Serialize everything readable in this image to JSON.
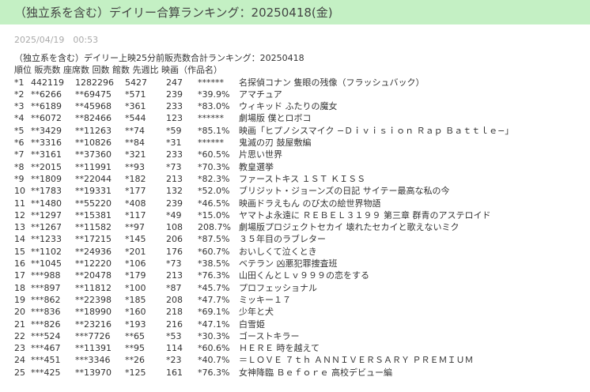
{
  "header": {
    "title": "（独立系を含む）デイリー合算ランキング：20250418(金)"
  },
  "post": {
    "date": "2025/04/19　00:53",
    "subtitle": "（独立系を含む）デイリー上映25分前販売数合計ランキング：20250418",
    "columns_line": "順位 販売数 座席数 回数 館数 先週比 映画（作品名）"
  },
  "ranking": [
    {
      "rank": "*1",
      "sales": "442119",
      "seats": "1282296",
      "shows": "5427",
      "halls": "247",
      "ratio": "******",
      "title": "名探偵コナン 隻眼の残像（フラッシュバック）"
    },
    {
      "rank": "*2",
      "sales": "**6266",
      "seats": "**69475",
      "shows": "*571",
      "halls": "239",
      "ratio": "*39.9%",
      "title": "アマチュア"
    },
    {
      "rank": "*3",
      "sales": "**6189",
      "seats": "**45968",
      "shows": "*361",
      "halls": "233",
      "ratio": "*83.0%",
      "title": "ウィキッド ふたりの魔女"
    },
    {
      "rank": "*4",
      "sales": "**6072",
      "seats": "**82466",
      "shows": "*544",
      "halls": "123",
      "ratio": "******",
      "title": "劇場版 僕とロボコ"
    },
    {
      "rank": "*5",
      "sales": "**3429",
      "seats": "**11263",
      "shows": "**74",
      "halls": "*59",
      "ratio": "*85.1%",
      "title": "映画「ヒプノシスマイク −Ｄｉｖｉｓｉｏｎ Ｒａｐ Ｂａｔｔｌｅ−」"
    },
    {
      "rank": "*6",
      "sales": "**3316",
      "seats": "**10826",
      "shows": "**84",
      "halls": "*31",
      "ratio": "******",
      "title": "鬼滅の刃 鼓屋敷編"
    },
    {
      "rank": "*7",
      "sales": "**3161",
      "seats": "**37360",
      "shows": "*321",
      "halls": "233",
      "ratio": "*60.5%",
      "title": "片思い世界"
    },
    {
      "rank": "*8",
      "sales": "**2015",
      "seats": "**11991",
      "shows": "**93",
      "halls": "*73",
      "ratio": "*70.3%",
      "title": "教皇選挙"
    },
    {
      "rank": "*9",
      "sales": "**1809",
      "seats": "**22044",
      "shows": "*182",
      "halls": "213",
      "ratio": "*82.3%",
      "title": "ファーストキス １ＳＴ ＫＩＳＳ"
    },
    {
      "rank": "10",
      "sales": "**1783",
      "seats": "**19331",
      "shows": "*177",
      "halls": "132",
      "ratio": "*52.0%",
      "title": "ブリジット・ジョーンズの日記 サイテー最高な私の今"
    },
    {
      "rank": "11",
      "sales": "**1480",
      "seats": "**55220",
      "shows": "*408",
      "halls": "239",
      "ratio": "*46.5%",
      "title": "映画ドラえもん のび太の絵世界物語"
    },
    {
      "rank": "12",
      "sales": "**1297",
      "seats": "**15381",
      "shows": "*117",
      "halls": "*49",
      "ratio": "*15.0%",
      "title": "ヤマトよ永遠に ＲＥＢＥＬ３１９９ 第三章 群青のアステロイド"
    },
    {
      "rank": "13",
      "sales": "**1267",
      "seats": "**11582",
      "shows": "**97",
      "halls": "108",
      "ratio": "208.7%",
      "title": "劇場版プロジェクトセカイ 壊れたセカイと歌えないミク"
    },
    {
      "rank": "14",
      "sales": "**1233",
      "seats": "**17215",
      "shows": "*145",
      "halls": "206",
      "ratio": "*87.5%",
      "title": "３５年目のラブレター"
    },
    {
      "rank": "15",
      "sales": "**1102",
      "seats": "**24936",
      "shows": "*201",
      "halls": "176",
      "ratio": "*60.7%",
      "title": "おいしくて泣くとき"
    },
    {
      "rank": "16",
      "sales": "**1045",
      "seats": "**12220",
      "shows": "*106",
      "halls": "*73",
      "ratio": "*38.5%",
      "title": "ベテラン 凶悪犯罪捜査班"
    },
    {
      "rank": "17",
      "sales": "***988",
      "seats": "**20478",
      "shows": "*179",
      "halls": "213",
      "ratio": "*76.3%",
      "title": "山田くんとＬｖ９９９の恋をする"
    },
    {
      "rank": "18",
      "sales": "***897",
      "seats": "**11812",
      "shows": "*100",
      "halls": "*87",
      "ratio": "*45.7%",
      "title": "プロフェッショナル"
    },
    {
      "rank": "19",
      "sales": "***862",
      "seats": "**22398",
      "shows": "*185",
      "halls": "208",
      "ratio": "*47.7%",
      "title": "ミッキー１７"
    },
    {
      "rank": "20",
      "sales": "***836",
      "seats": "**18990",
      "shows": "*160",
      "halls": "218",
      "ratio": "*69.1%",
      "title": "少年と犬"
    },
    {
      "rank": "21",
      "sales": "***826",
      "seats": "**23216",
      "shows": "*193",
      "halls": "216",
      "ratio": "*47.1%",
      "title": "白雪姫"
    },
    {
      "rank": "22",
      "sales": "***524",
      "seats": "***7726",
      "shows": "**65",
      "halls": "*53",
      "ratio": "*30.3%",
      "title": "ゴーストキラー"
    },
    {
      "rank": "23",
      "sales": "***467",
      "seats": "**11391",
      "shows": "**95",
      "halls": "114",
      "ratio": "*60.6%",
      "title": "ＨＥＲＥ 時を越えて"
    },
    {
      "rank": "24",
      "sales": "***451",
      "seats": "***3346",
      "shows": "**26",
      "halls": "*23",
      "ratio": "*40.7%",
      "title": "＝ＬＯＶＥ ７ｔｈ ＡＮＮＩＶＥＲＳＡＲＹ ＰＲＥＭＩＵＭ"
    },
    {
      "rank": "25",
      "sales": "***425",
      "seats": "**13970",
      "shows": "*125",
      "halls": "161",
      "ratio": "*76.3%",
      "title": "女神降臨 Ｂｅｆｏｒｅ 高校デビュー編"
    }
  ],
  "colors": {
    "title_bar_bg": "#c4f0c4",
    "date_text": "#aaaaaa",
    "body_text": "#333333"
  }
}
